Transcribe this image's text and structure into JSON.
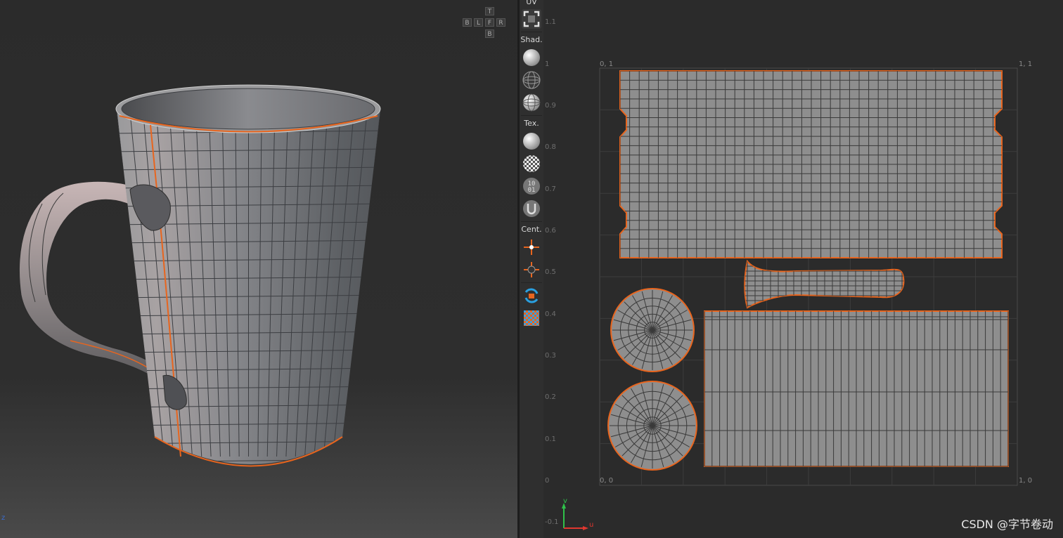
{
  "viewport3d": {
    "viewcube": {
      "top": "T",
      "back": "B",
      "left": "L",
      "front": "F",
      "right": "R",
      "bottom": "B"
    },
    "axis_label": "z"
  },
  "toolbar": {
    "uv_label": "UV",
    "shading_label": "Shad.",
    "texture_label": "Tex.",
    "center_label": "Cent.",
    "icons": [
      "uv-frame-icon",
      "shaded-sphere-icon",
      "wireframe-sphere-icon",
      "lit-wire-sphere-icon",
      "texture-sphere-icon",
      "checker-sphere-icon",
      "binary-sphere-icon",
      "uv-sphere-icon",
      "center-icon",
      "center-grid-icon",
      "rotate-lock-icon",
      "checker-grid-icon"
    ]
  },
  "uv_editor": {
    "v_ticks": [
      "1.1",
      "1",
      "0.9",
      "0.8",
      "0.7",
      "0.6",
      "0.5",
      "0.4",
      "0.3",
      "0.2",
      "0.1",
      "0",
      "-0.1"
    ],
    "corners": {
      "top_left": "0, 1",
      "top_right": "1, 1",
      "bottom_left": "0, 0",
      "bottom_right": "1, 0"
    },
    "axis_v": "v",
    "axis_u": "u",
    "colors": {
      "seam": "#e8651e",
      "mesh_fill": "#8e8e8e",
      "grid": "#3d3d3d",
      "axis_v": "#2fc14a",
      "axis_u": "#e0372f"
    }
  },
  "watermark": "CSDN @字节卷动"
}
